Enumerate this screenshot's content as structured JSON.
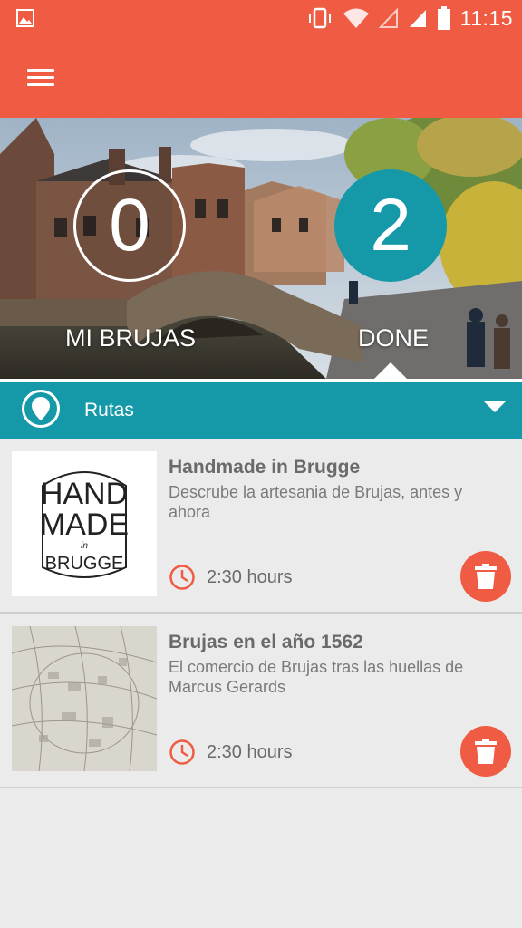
{
  "status_bar": {
    "time": "11:15",
    "icons": [
      "gallery-icon",
      "vibrate-icon",
      "wifi-icon",
      "signal-icon",
      "signal-icon",
      "battery-icon"
    ]
  },
  "app_bar": {
    "menu_icon": "hamburger-menu-icon"
  },
  "hero": {
    "mine_count": "0",
    "mine_label": "MI BRUJAS",
    "done_count": "2",
    "done_label": "DONE",
    "selected_tab": "done"
  },
  "filter": {
    "label": "Rutas",
    "icon": "location-pin-icon",
    "dropdown_icon": "chevron-down-icon"
  },
  "routes": [
    {
      "title": "Handmade in Brugge",
      "description": "Descrube la artesania de Brujas, antes y ahora",
      "duration": "2:30 hours",
      "thumb_logo": {
        "line1": "HAND",
        "line2": "MADE",
        "line3": "in",
        "line4": "BRUGGE"
      }
    },
    {
      "title": "Brujas en el año 1562",
      "description": "El comercio de Brujas tras las huellas de Marcus Gerards",
      "duration": "2:30 hours"
    }
  ],
  "colors": {
    "primary": "#ef5b43",
    "accent": "#1599a8",
    "background": "#ebebeb"
  }
}
